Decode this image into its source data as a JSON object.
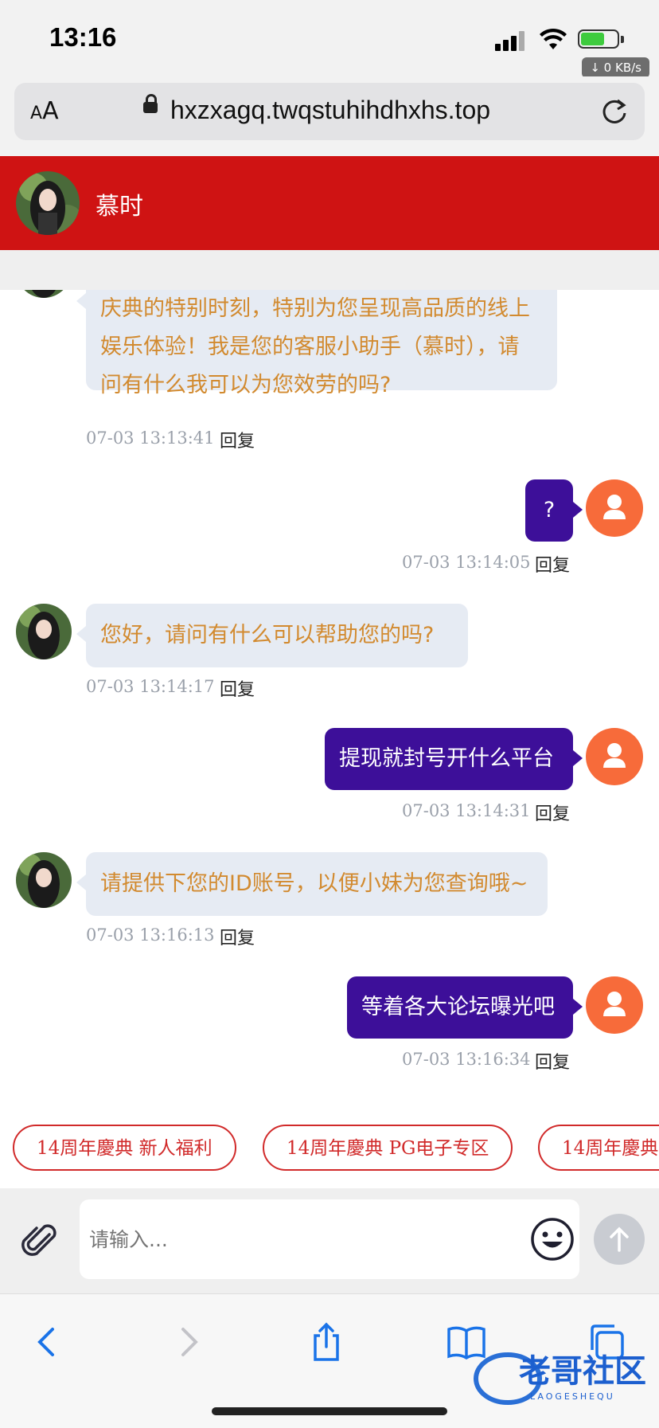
{
  "status_bar": {
    "time": "13:16",
    "network_speed": "↓ 0 KB/s",
    "icons": [
      "signal-icon",
      "wifi-icon",
      "battery-charging-icon"
    ]
  },
  "browser": {
    "aa_label_small": "A",
    "aa_label_large": "A",
    "url": "hxzxagq.twqstuhihdhxhs.top",
    "icons": [
      "lock-icon",
      "reload-icon"
    ]
  },
  "header": {
    "agent_name": "慕时",
    "color": "#cf1313"
  },
  "messages": [
    {
      "from": "agent",
      "text_lines": [
        "庆典的特别时刻，特别为您呈现高品质的线上",
        "娱乐体验！我是您的客服小助手（慕时），请",
        "问有什么我可以为您效劳的吗?"
      ],
      "time": "07-03 13:13:41",
      "reply": "回复"
    },
    {
      "from": "user",
      "text": "?",
      "time": "07-03 13:14:05",
      "reply": "回复"
    },
    {
      "from": "agent",
      "text": "您好，请问有什么可以帮助您的吗?",
      "time": "07-03 13:14:17",
      "reply": "回复"
    },
    {
      "from": "user",
      "text": "提现就封号开什么平台",
      "time": "07-03 13:14:31",
      "reply": "回复"
    },
    {
      "from": "agent",
      "text": "请提供下您的ID账号，以便小妹为您查询哦~",
      "time": "07-03 13:16:13",
      "reply": "回复"
    },
    {
      "from": "user",
      "text": "等着各大论坛曝光吧",
      "time": "07-03 13:16:34",
      "reply": "回复"
    }
  ],
  "quick_tags": [
    "14周年慶典 新人福利",
    "14周年慶典 PG电子专区",
    "14周年慶典"
  ],
  "composer": {
    "placeholder": "请输入...",
    "icons": [
      "paperclip-icon",
      "emoji-icon",
      "send-arrow-icon"
    ]
  },
  "toolbar": {
    "icons": [
      "back-icon",
      "forward-icon",
      "share-icon",
      "bookmarks-icon",
      "tabs-icon"
    ]
  },
  "watermark": {
    "text": "老哥社区",
    "subtext": "LAOGESHEQU"
  },
  "colors": {
    "user_bubble": "#3d0f99",
    "agent_bubble": "#e6ebf3",
    "agent_text": "#d28a2f",
    "user_avatar": "#f76b3a",
    "tag_border": "#d12a2a"
  }
}
